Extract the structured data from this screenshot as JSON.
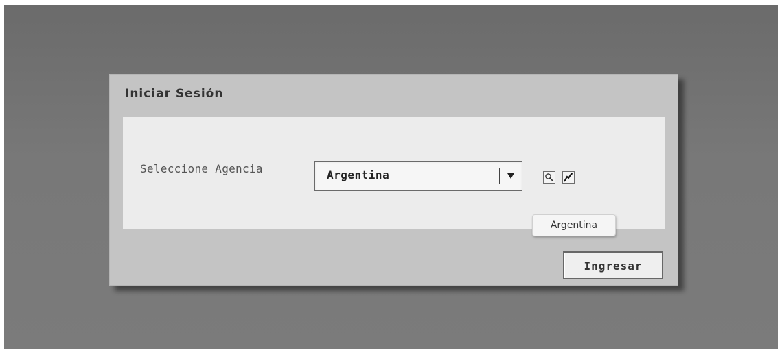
{
  "dialog": {
    "title": "Iniciar Sesión"
  },
  "agency": {
    "label": "Seleccione Agencia",
    "selected": "Argentina",
    "tooltip": "Argentina",
    "icons": {
      "search": "search-icon",
      "edit": "edit-icon",
      "dropdown": "chevron-down-icon"
    }
  },
  "actions": {
    "submit_label": "Ingresar"
  },
  "colors": {
    "backdrop": "#717171",
    "dialog": "#c4c4c4",
    "panel": "#ececec",
    "text": "#333333"
  }
}
